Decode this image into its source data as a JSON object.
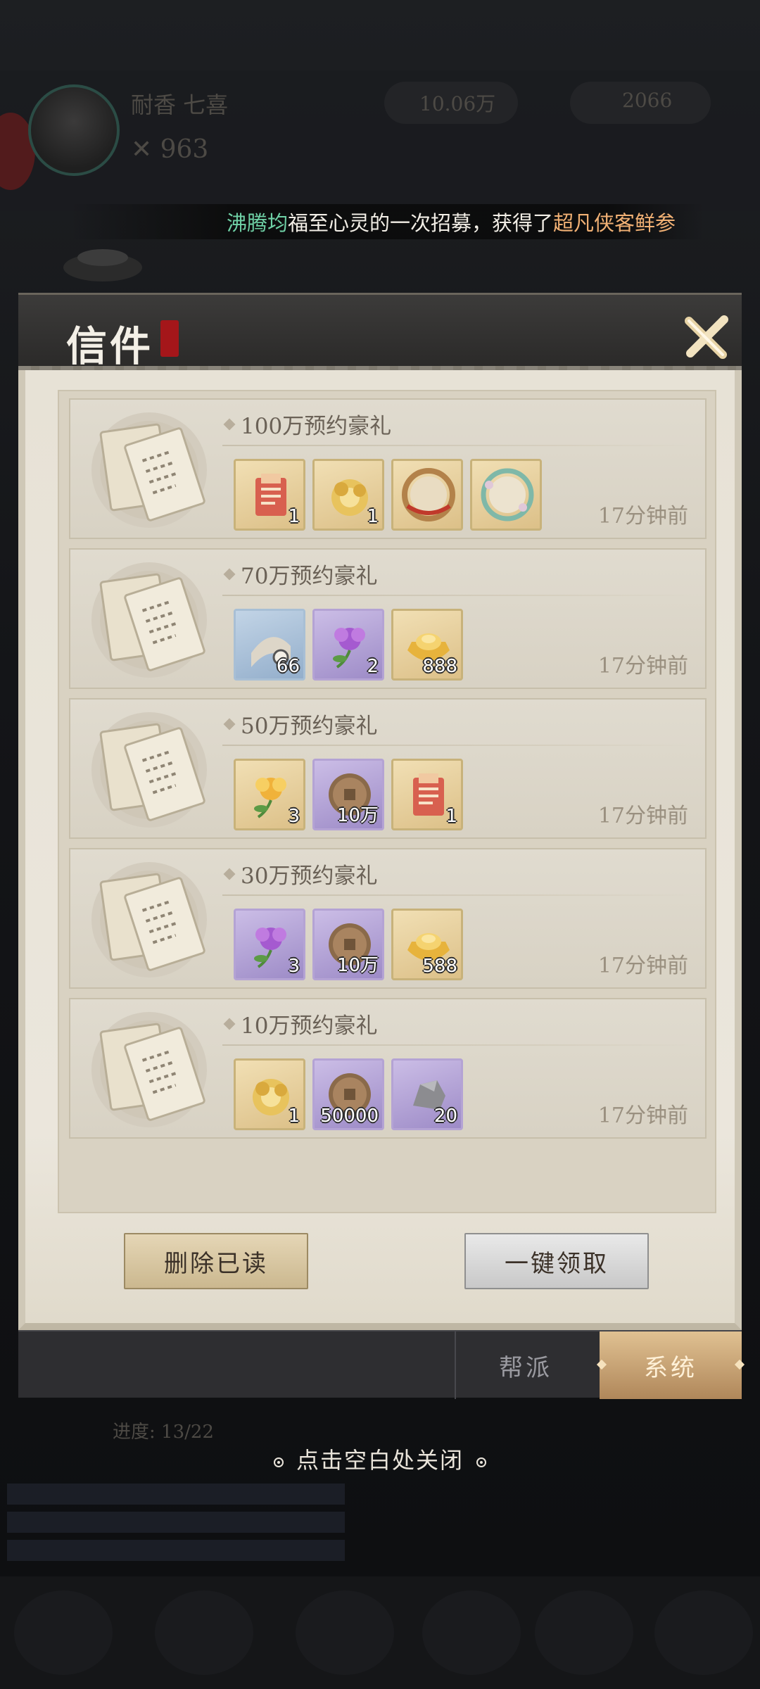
{
  "marquee": {
    "player_name": "沸腾均",
    "middle_text": "福至心灵的一次招募，获得了",
    "item_name": "超凡侠客鲜参"
  },
  "background": {
    "player_label": "耐香 七喜",
    "power": "963",
    "currency1": "10.06万",
    "currency2": "2066",
    "progress": "进度: 13/22"
  },
  "dialog": {
    "title": "信件",
    "close_icon": "close-x-icon"
  },
  "mails": [
    {
      "title": "100万预约豪礼",
      "time": "17分钟前",
      "rewards": [
        {
          "icon": "red-scroll-ticket",
          "count": "1",
          "rarity": "gold"
        },
        {
          "icon": "gold-flower-token",
          "count": "1",
          "rarity": "gold"
        },
        {
          "icon": "avatar-frame-red",
          "count": "",
          "rarity": "gold"
        },
        {
          "icon": "avatar-frame-jade",
          "count": "",
          "rarity": "gold"
        }
      ]
    },
    {
      "title": "70万预约豪礼",
      "time": "17分钟前",
      "rewards": [
        {
          "icon": "scroll-token",
          "count": "66",
          "rarity": "blue"
        },
        {
          "icon": "purple-flower",
          "count": "2",
          "rarity": "purple"
        },
        {
          "icon": "gold-ingot",
          "count": "888",
          "rarity": "gold"
        }
      ]
    },
    {
      "title": "50万预约豪礼",
      "time": "17分钟前",
      "rewards": [
        {
          "icon": "gold-flower",
          "count": "3",
          "rarity": "gold"
        },
        {
          "icon": "copper-coin",
          "count": "10万",
          "rarity": "purple"
        },
        {
          "icon": "red-scroll-ticket",
          "count": "1",
          "rarity": "gold"
        }
      ]
    },
    {
      "title": "30万预约豪礼",
      "time": "17分钟前",
      "rewards": [
        {
          "icon": "purple-flower",
          "count": "3",
          "rarity": "purple"
        },
        {
          "icon": "copper-coin",
          "count": "10万",
          "rarity": "purple"
        },
        {
          "icon": "gold-ingot",
          "count": "588",
          "rarity": "gold"
        }
      ]
    },
    {
      "title": "10万预约豪礼",
      "time": "17分钟前",
      "rewards": [
        {
          "icon": "gold-flower-token",
          "count": "1",
          "rarity": "gold"
        },
        {
          "icon": "copper-coin",
          "count": "50000",
          "rarity": "purple"
        },
        {
          "icon": "iron-ore",
          "count": "20",
          "rarity": "purple"
        }
      ]
    }
  ],
  "buttons": {
    "delete_read": "删除已读",
    "claim_all": "一键领取"
  },
  "tabs": {
    "guild": "帮派",
    "system": "系统"
  },
  "close_hint": "点击空白处关闭",
  "colors": {
    "marquee_name": "#6fd1a6",
    "marquee_item": "#f0b074",
    "active_tab": "#c79d6b"
  }
}
